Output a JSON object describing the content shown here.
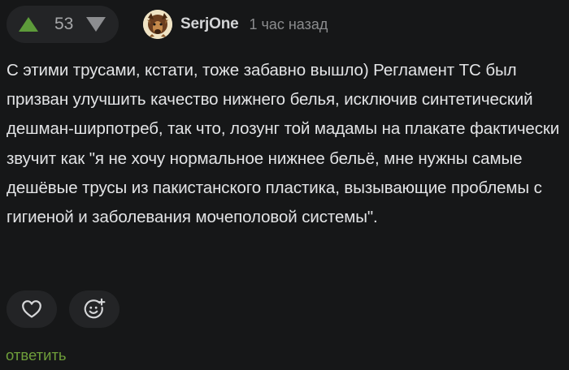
{
  "vote": {
    "count": "53",
    "up_icon": "arrow-up-icon",
    "down_icon": "arrow-down-icon",
    "up_color": "#5d9b3a",
    "down_color": "#8c8d90"
  },
  "author": {
    "name": "SerjOne",
    "avatar_icon": "avatar-image",
    "time": "1 час назад"
  },
  "comment": {
    "text": "С этими трусами, кстати, тоже забавно вышло) Регламент ТС был призван улучшить качество нижнего белья, исключив синтетический дешман-ширпотреб, так что, лозунг той мадамы на плакате фактически звучит как \"я не хочу нормальное нижнее бельё, мне нужны самые дешёвые трусы из пакистанского пластика, вызывающие проблемы с гигиеной и заболевания мочеполовой системы\"."
  },
  "actions": {
    "like_icon": "heart-icon",
    "reaction_icon": "add-emoji-icon",
    "reply_label": "ответить",
    "reply_color": "#6e9e3a"
  }
}
